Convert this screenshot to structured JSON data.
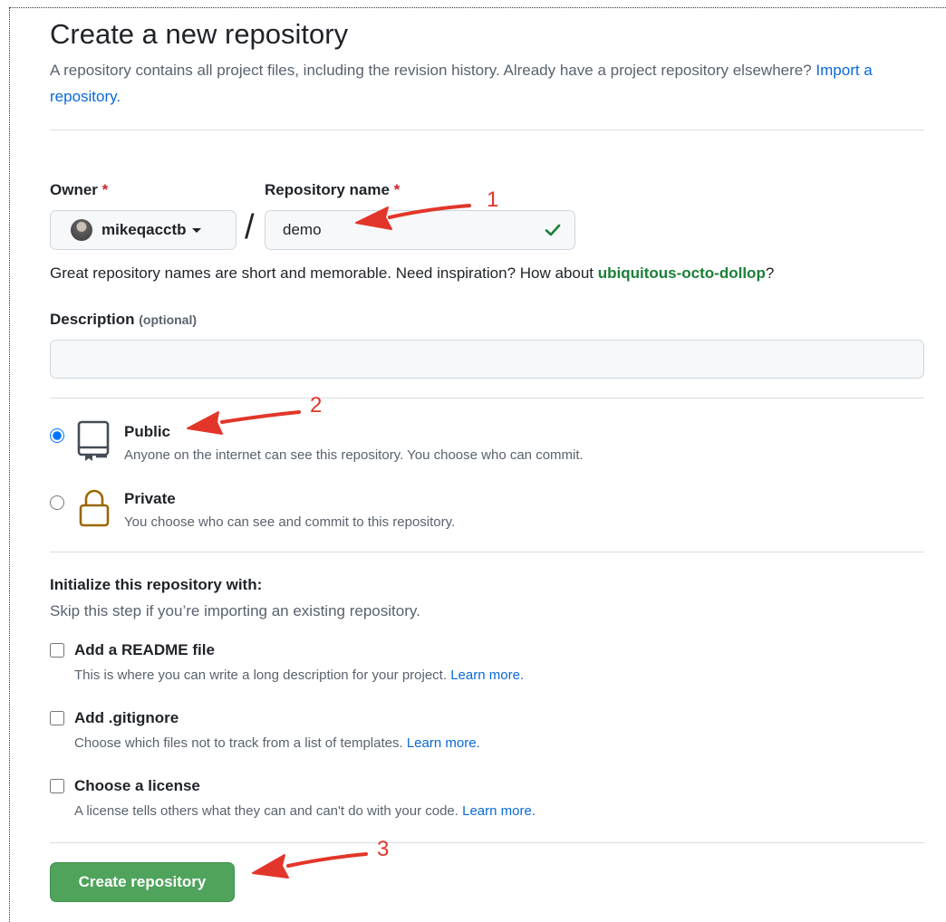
{
  "header": {
    "title": "Create a new repository",
    "description_prefix": "A repository contains all project files, including the revision history. Already have a project repository elsewhere? ",
    "import_link": "Import a repository."
  },
  "owner": {
    "label": "Owner",
    "required_mark": "*",
    "value": "mikeqacctb"
  },
  "repo_name": {
    "label": "Repository name",
    "required_mark": "*",
    "value": "demo",
    "separator": "/"
  },
  "name_hint": {
    "prefix": "Great repository names are short and memorable. Need inspiration? How about ",
    "suggestion": "ubiquitous-octo-dollop",
    "suffix": "?"
  },
  "description": {
    "label": "Description",
    "optional": "(optional)",
    "value": ""
  },
  "visibility": {
    "selected": "public",
    "options": [
      {
        "key": "public",
        "title": "Public",
        "desc": "Anyone on the internet can see this repository. You choose who can commit.",
        "icon": "repo-icon"
      },
      {
        "key": "private",
        "title": "Private",
        "desc": "You choose who can see and commit to this repository.",
        "icon": "lock-icon"
      }
    ]
  },
  "initialize": {
    "title": "Initialize this repository with:",
    "subtitle": "Skip this step if you’re importing an existing repository.",
    "items": [
      {
        "title": "Add a README file",
        "desc": "This is where you can write a long description for your project. ",
        "link": "Learn more.",
        "checked": false
      },
      {
        "title": "Add .gitignore",
        "desc": "Choose which files not to track from a list of templates. ",
        "link": "Learn more.",
        "checked": false
      },
      {
        "title": "Choose a license",
        "desc": "A license tells others what they can and can't do with your code. ",
        "link": "Learn more.",
        "checked": false
      }
    ]
  },
  "submit": {
    "label": "Create repository"
  },
  "annotations": {
    "one": "1",
    "two": "2",
    "three": "3"
  },
  "colors": {
    "primary_button": "#4fa35b",
    "link": "#0969da",
    "suggestion": "#1a7f37",
    "annotation": "#e2362a",
    "valid_check": "#1a7f37"
  }
}
